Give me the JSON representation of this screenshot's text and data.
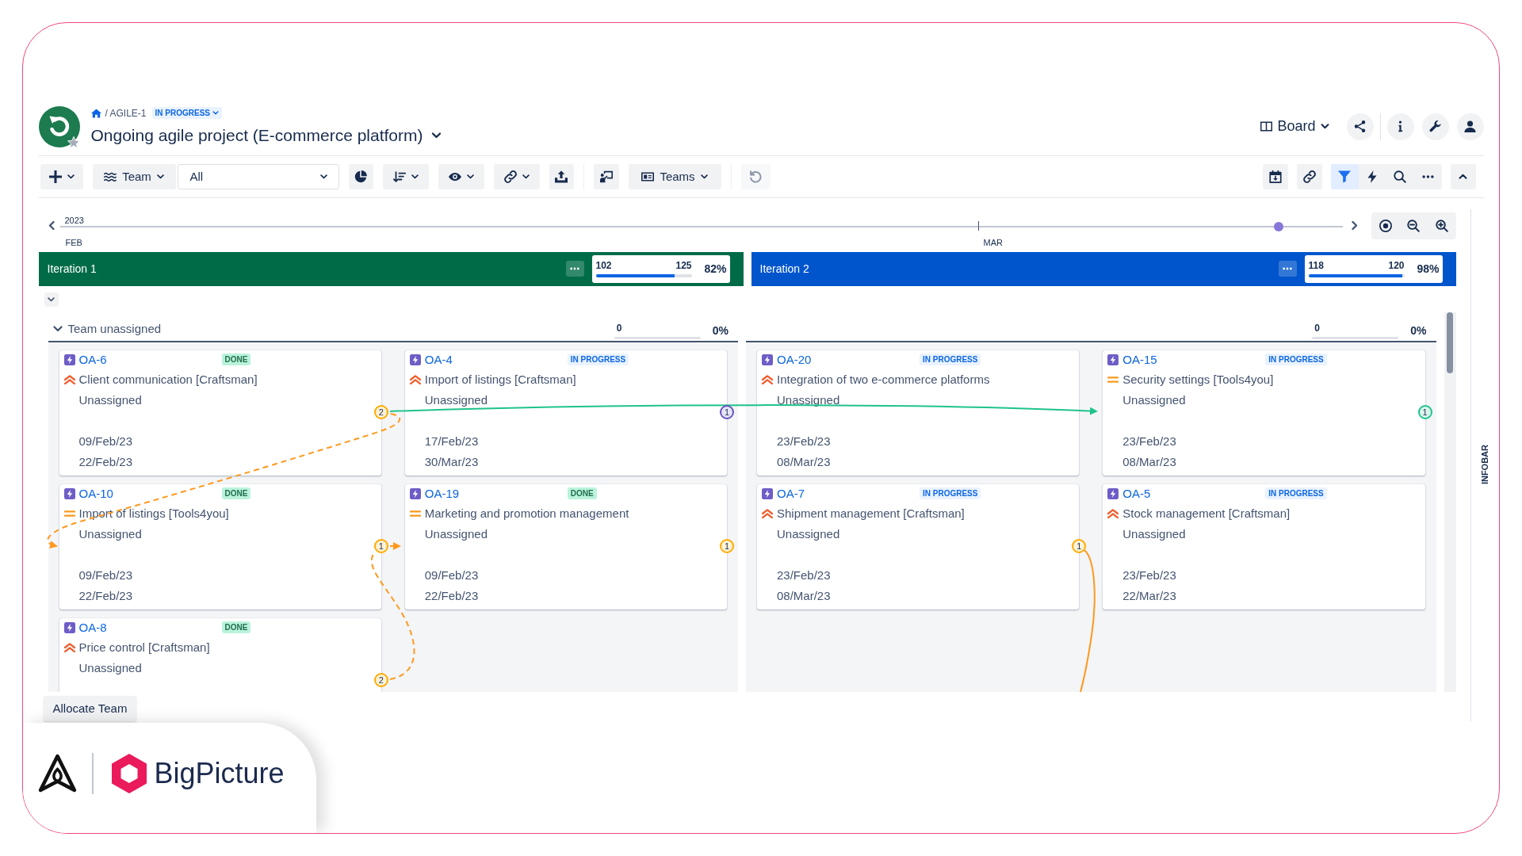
{
  "header": {
    "breadcrumb": {
      "path": "/ AGILE-1",
      "status": "IN PROGRESS"
    },
    "title": "Ongoing agile project (E-commerce platform)",
    "starred": false,
    "view": "Board"
  },
  "toolbar": {
    "group_by": "Team",
    "team_filter": "All",
    "layout": "Teams",
    "undo_disabled": true,
    "filter_on": true
  },
  "timeline": {
    "year": "2023",
    "months": [
      {
        "label": "FEB"
      },
      {
        "label": "MAR"
      }
    ],
    "level": 0.95
  },
  "iterations": [
    {
      "name": "Iteration 1",
      "color": "#006c47",
      "numbers": [
        "102",
        "125"
      ],
      "level": 0.82,
      "percent": "82%"
    },
    {
      "name": "Iteration 2",
      "color": "#0055cc",
      "numbers": [
        "118",
        "120"
      ],
      "level": 0.98,
      "percent": "98%"
    }
  ],
  "team_group": {
    "name": "Team unassigned",
    "expanded": true,
    "stats": [
      {
        "value": "0",
        "percent": "0%"
      },
      {
        "value": "0",
        "percent": "0%"
      }
    ]
  },
  "lanes": [
    {
      "cards": [
        {
          "id": "OA-6",
          "status": {
            "label": "DONE",
            "kind": "done"
          },
          "priority": {
            "kind": "high"
          },
          "title": "Client communication [Craftsman]",
          "assignee": "Unassigned",
          "dates": [
            "09/Feb/23",
            "22/Feb/23"
          ],
          "dependency": {
            "count": "2",
            "color": "#ffab00"
          }
        },
        {
          "id": "OA-4",
          "status": {
            "label": "IN PROGRESS",
            "kind": "progress"
          },
          "priority": {
            "kind": "high"
          },
          "title": "Import of listings [Craftsman]",
          "assignee": "Unassigned",
          "dates": [
            "17/Feb/23",
            "30/Mar/23"
          ],
          "dependency": {
            "count": "1",
            "color": "#6554c0"
          }
        },
        {
          "id": "OA-10",
          "status": {
            "label": "DONE",
            "kind": "done"
          },
          "priority": {
            "kind": "medium"
          },
          "title": "Import of listings [Tools4you]",
          "assignee": "Unassigned",
          "dates": [
            "09/Feb/23",
            "22/Feb/23"
          ],
          "dependency": {
            "count": "1",
            "color": "#ffab00"
          }
        },
        {
          "id": "OA-19",
          "status": {
            "label": "DONE",
            "kind": "done"
          },
          "priority": {
            "kind": "medium"
          },
          "title": "Marketing and promotion management",
          "assignee": "Unassigned",
          "dates": [
            "09/Feb/23",
            "22/Feb/23"
          ],
          "dependency": {
            "count": "1",
            "color": "#ffab00"
          }
        },
        {
          "id": "OA-8",
          "status": {
            "label": "DONE",
            "kind": "done"
          },
          "priority": {
            "kind": "high"
          },
          "title": "Price control [Craftsman]",
          "assignee": "Unassigned",
          "dependency": {
            "count": "2",
            "color": "#ffab00"
          }
        }
      ]
    },
    {
      "cards": [
        {
          "id": "OA-20",
          "status": {
            "label": "IN PROGRESS",
            "kind": "progress"
          },
          "priority": {
            "kind": "high"
          },
          "title": "Integration of two e-commerce platforms",
          "assignee": "Unassigned",
          "dates": [
            "23/Feb/23",
            "08/Mar/23"
          ]
        },
        {
          "id": "OA-15",
          "status": {
            "label": "IN PROGRESS",
            "kind": "progress"
          },
          "priority": {
            "kind": "medium"
          },
          "title": "Security settings [Tools4you]",
          "assignee": "Unassigned",
          "dates": [
            "23/Feb/23",
            "08/Mar/23"
          ],
          "dependency": {
            "count": "1",
            "color": "#1fc38c"
          }
        },
        {
          "id": "OA-7",
          "status": {
            "label": "IN PROGRESS",
            "kind": "progress"
          },
          "priority": {
            "kind": "high"
          },
          "title": "Shipment management [Craftsman]",
          "assignee": "Unassigned",
          "dates": [
            "23/Feb/23",
            "08/Mar/23"
          ],
          "dependency": {
            "count": "1",
            "color": "#ffab00"
          }
        },
        {
          "id": "OA-5",
          "status": {
            "label": "IN PROGRESS",
            "kind": "progress"
          },
          "priority": {
            "kind": "high"
          },
          "title": "Stock management [Craftsman]",
          "assignee": "Unassigned",
          "dates": [
            "23/Feb/23",
            "22/Mar/23"
          ]
        }
      ]
    }
  ],
  "allocate_button": "Allocate Team",
  "infobar": "INFOBAR",
  "brand": {
    "name": "BigPicture"
  }
}
